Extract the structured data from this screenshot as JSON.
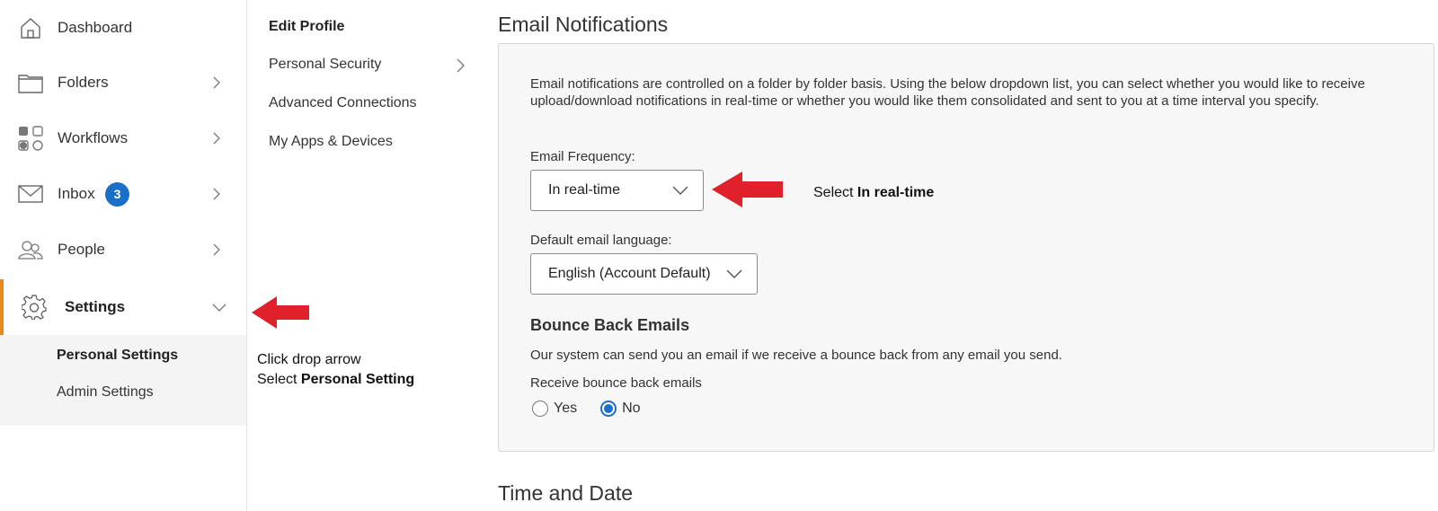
{
  "sidebar": {
    "items": [
      {
        "label": "Dashboard",
        "icon": "home-icon"
      },
      {
        "label": "Folders",
        "icon": "folder-icon"
      },
      {
        "label": "Workflows",
        "icon": "workflow-icon"
      },
      {
        "label": "Inbox",
        "icon": "mail-icon",
        "badge": "3"
      },
      {
        "label": "People",
        "icon": "people-icon"
      },
      {
        "label": "Settings",
        "icon": "gear-icon",
        "active": true
      }
    ],
    "sub_items": [
      {
        "label": "Personal Settings",
        "selected": true
      },
      {
        "label": "Admin Settings"
      }
    ],
    "accent_color": "#e58a1f",
    "badge_color": "#1a6fc9"
  },
  "settings_menu": {
    "items": [
      {
        "label": "Edit Profile",
        "selected": true
      },
      {
        "label": "Personal Security"
      },
      {
        "label": "Advanced Connections"
      },
      {
        "label": "My Apps & Devices"
      }
    ]
  },
  "main": {
    "email_section_title": "Email Notifications",
    "description": "Email notifications are controlled on a folder by folder basis. Using the below dropdown list, you can select whether you would like to receive upload/download notifications in real-time or whether you would like them consolidated and sent to you at a time interval you specify.",
    "frequency_label": "Email Frequency:",
    "frequency_value": "In real-time",
    "language_label": "Default email language:",
    "language_value": "English (Account Default)",
    "bounce_title": "Bounce Back Emails",
    "bounce_desc": "Our system can send you an email if we receive a bounce back from any email you send.",
    "bounce_label": "Receive bounce back emails",
    "bounce_options": [
      {
        "label": "Yes",
        "checked": false
      },
      {
        "label": "No",
        "checked": true
      }
    ],
    "time_section_title": "Time and Date"
  },
  "annotations": {
    "frequency_prefix": "Select ",
    "frequency_bold": "In real-time",
    "settings_line1": "Click drop arrow",
    "settings_line2_prefix": "Select ",
    "settings_line2_bold": "Personal Setting",
    "arrow_color": "#e0202a"
  }
}
